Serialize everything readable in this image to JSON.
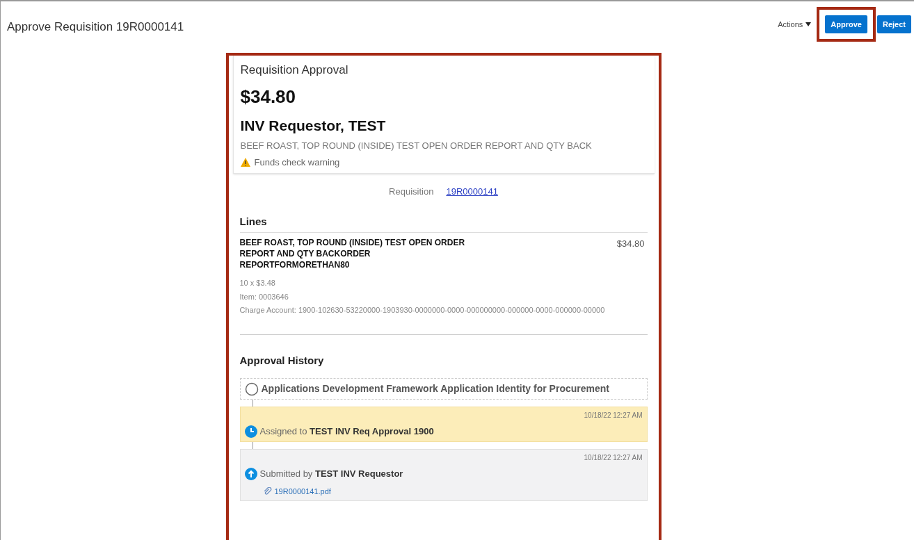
{
  "page_title": "Approve Requisition 19R0000141",
  "toolbar": {
    "actions_menu": "Actions",
    "buttons": [
      {
        "label": "Approve",
        "highlighted": true
      },
      {
        "label": "Reject",
        "highlighted": false
      }
    ]
  },
  "card": {
    "highlighted": true,
    "header": {
      "title": "Requisition Approval",
      "amount": "$34.80",
      "requester": "INV Requestor, TEST",
      "description": "BEEF ROAST, TOP ROUND (INSIDE) TEST OPEN ORDER REPORT AND QTY BACK",
      "warning": "Funds check warning"
    },
    "requisition": {
      "label": "Requisition",
      "link": "19R0000141"
    },
    "lines": {
      "heading": "Lines",
      "items": [
        {
          "title": "BEEF ROAST, TOP ROUND (INSIDE) TEST OPEN ORDER REPORT AND QTY BACKORDER REPORTFORMORETHAN80",
          "amount": "$34.80",
          "details": [
            "10 x $3.48",
            "Item: 0003646",
            "Charge Account: 1900-102630-53220000-1903930-0000000-0000-000000000-000000-0000-000000-00000"
          ]
        }
      ]
    },
    "history": {
      "heading": "Approval History",
      "items": [
        {
          "kind": "pending",
          "text": "**Applications Development Framework Application Identity for Procurement**"
        },
        {
          "kind": "assigned",
          "time": "10/18/22 12:27 AM",
          "text": "Assigned to **TEST INV Req Approval 1900**"
        },
        {
          "kind": "submitted",
          "time": "10/18/22 12:27 AM",
          "text": "Submitted by **TEST INV Requestor**",
          "attachment": "19R0000141.pdf"
        }
      ]
    }
  }
}
